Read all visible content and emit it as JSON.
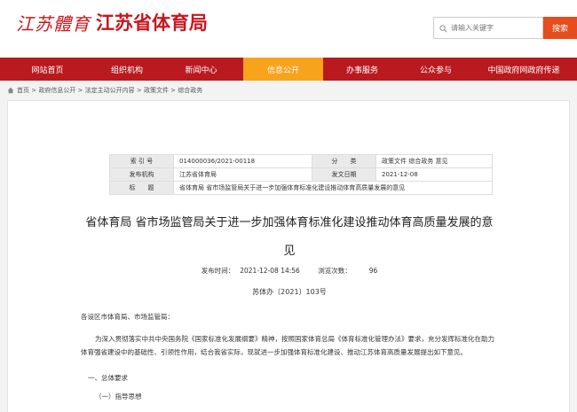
{
  "header": {
    "logo_script": "江苏體育",
    "logo_text": "江苏省体育局",
    "search_placeholder": "请输入关键字",
    "search_button": "搜索"
  },
  "nav": {
    "items": [
      {
        "label": "网站首页",
        "active": false
      },
      {
        "label": "组织机构",
        "active": false
      },
      {
        "label": "新闻中心",
        "active": false
      },
      {
        "label": "信息公开",
        "active": true
      },
      {
        "label": "办事服务",
        "active": false
      },
      {
        "label": "公众参与",
        "active": false
      },
      {
        "label": "中国政府网政府传递",
        "active": false
      }
    ]
  },
  "breadcrumb": "首页 > 政府信息公开 > 法定主动公开内容 > 政策文件 > 综合政务",
  "meta": {
    "index_label": "索 引 号",
    "index_value": "014000036/2021-00118",
    "category_label": "分　　类",
    "category_value": "政策文件 综合政务 意见",
    "org_label": "发布机构",
    "org_value": "江苏省体育局",
    "date_label": "发文日期",
    "date_value": "2021-12-08",
    "subject_label": "标　　题",
    "subject_value": "省体育局 省市场监管局关于进一步加强体育标准化建设推动体育高质量发展的意见"
  },
  "article": {
    "title_line1": "省体育局 省市场监管局关于进一步加强体育标准化建设推动体育高质量发展的意",
    "title_line2": "见",
    "publish_time_label": "发布时间：",
    "publish_time": "2021-12-08 14:56",
    "views_label": "浏览次数：",
    "views": "96",
    "doc_number": "苏体办〔2021〕103号",
    "salutation": "各设区市体育局、市场监管局：",
    "paragraph1": "为深入贯彻落实中共中央国务院《国家标准化发展纲要》精神，按照国家体育总局《体育标准化管理办法》要求，充分发挥标准化在助力体育强省建设中的基础性、引领性作用，结合我省实际，现就进一步加强体育标准化建设、推动江苏体育高质量发展提出如下意见。",
    "heading1": "一、总体要求",
    "heading2": "（一）指导思想"
  }
}
